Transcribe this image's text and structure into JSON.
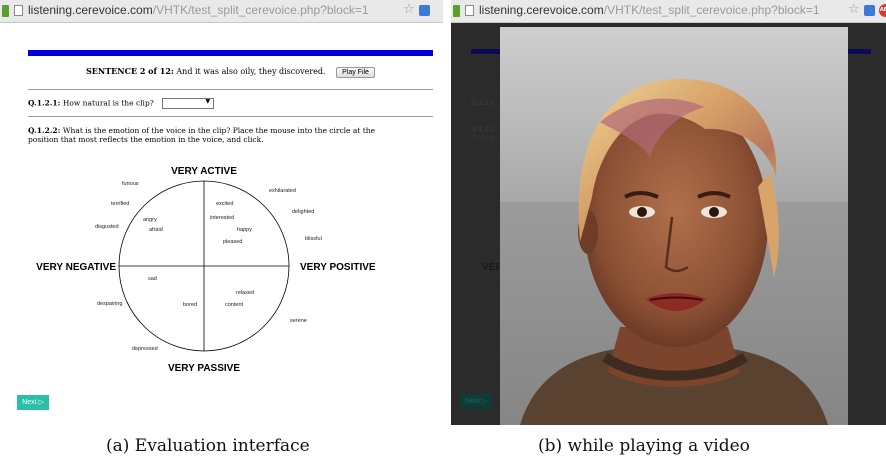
{
  "panel_a": {
    "browser": {
      "url_host": "listening.cerevoice.com",
      "url_path": "/VHTK/test_split_cerevoice.php?block=1"
    },
    "sentence": {
      "label": "SENTENCE 2 of 12:",
      "text": "And it was also oily, they discovered.",
      "play_button": "Play File"
    },
    "q1": {
      "label": "Q.1.2.1:",
      "text": "How natural is the clip?",
      "select_value": ""
    },
    "q2": {
      "label": "Q.1.2.2:",
      "text": "What is the emotion of the voice in the clip? Place the mouse into the circle at the position that most reflects the emotion in the voice, and click."
    },
    "axes": {
      "top": "VERY ACTIVE",
      "bottom": "VERY PASSIVE",
      "left": "VERY NEGATIVE",
      "right": "VERY POSITIVE"
    },
    "emotions": {
      "furious": "furious",
      "exhilarated": "exhilarated",
      "terrified": "terrified",
      "excited": "excited",
      "delighted": "delighted",
      "angry": "angry",
      "interested": "interested",
      "disgusted": "disgusted",
      "afraid": "afraid",
      "happy": "happy",
      "pleased": "pleased",
      "blissful": "blissful",
      "sad": "sad",
      "relaxed": "relaxed",
      "despairing": "despairing",
      "bored": "bored",
      "content": "content",
      "serene": "serene",
      "depressed": "depressed"
    },
    "next_button": "Next ▷"
  },
  "panel_b": {
    "browser": {
      "url_host": "listening.cerevoice.com",
      "url_path": "/VHTK/test_split_cerevoice.php?block=1"
    },
    "background_fragments": {
      "q_label": "Q.1.2.1",
      "q2_label": "Q.1.2.2",
      "q2_fragment": "at the po",
      "axis_fragment": "VEF"
    }
  },
  "captions": {
    "a": "(a) Evaluation interface",
    "b": "(b) while playing a video"
  }
}
